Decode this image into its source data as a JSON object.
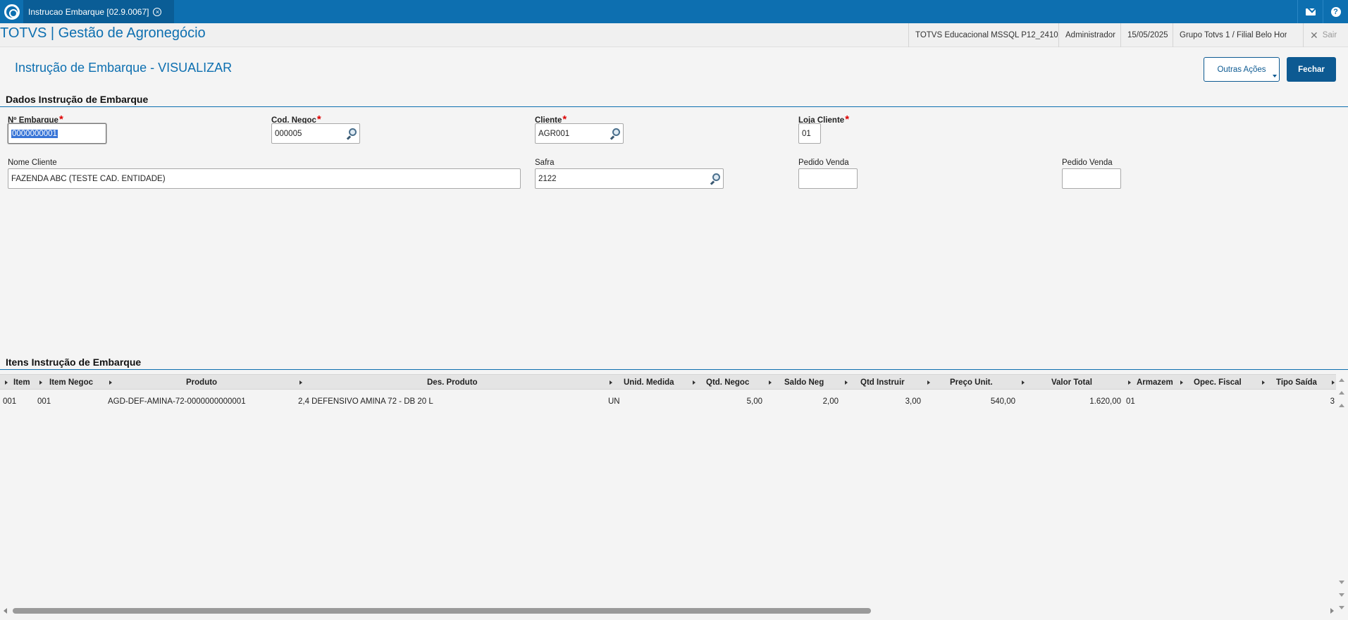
{
  "tab": {
    "title": "Instrucao Embarque [02.9.0067]"
  },
  "header": {
    "app_title": "TOTVS | Gestão de Agronegócio",
    "environment": "TOTVS Educacional MSSQL P12_2410",
    "user": "Administrador",
    "date": "15/05/2025",
    "branch": "Grupo Totvs 1 / Filial Belo Hor",
    "logout_label": "Sair"
  },
  "page": {
    "title": "Instrução de Embarque - VISUALIZAR",
    "other_actions_label": "Outras Ações",
    "close_label": "Fechar"
  },
  "form": {
    "section_title": "Dados Instrução de Embarque",
    "fields": {
      "num_embarque": {
        "label": "Nº Embarque",
        "value": "0000000001"
      },
      "cod_negoc": {
        "label": "Cod. Negoc",
        "value": "000005"
      },
      "cliente": {
        "label": "Cliente",
        "value": "AGR001"
      },
      "loja_cliente": {
        "label": "Loja Cliente",
        "value": "01"
      },
      "nome_cliente": {
        "label": "Nome Cliente",
        "value": "FAZENDA ABC (TESTE CAD. ENTIDADE)"
      },
      "safra": {
        "label": "Safra",
        "value": "2122"
      },
      "pedido_venda_1": {
        "label": "Pedido Venda",
        "value": ""
      },
      "pedido_venda_2": {
        "label": "Pedido Venda",
        "value": ""
      }
    }
  },
  "items": {
    "section_title": "Itens Instrução de Embarque",
    "columns": [
      "Item",
      "Item Negoc",
      "Produto",
      "Des. Produto",
      "Unid. Medida",
      "Qtd. Negoc",
      "Saldo Neg",
      "Qtd Instruir",
      "Preço Unit.",
      "Valor Total",
      "Armazem",
      "Opec. Fiscal",
      "Tipo Saída"
    ],
    "rows": [
      [
        "001",
        "001",
        "AGD-DEF-AMINA-72-0000000000001",
        "2,4 DEFENSIVO AMINA 72 - DB 20 L",
        "UN",
        "5,00",
        "2,00",
        "3,00",
        "540,00",
        "1.620,00",
        "01",
        "",
        "3"
      ]
    ]
  }
}
